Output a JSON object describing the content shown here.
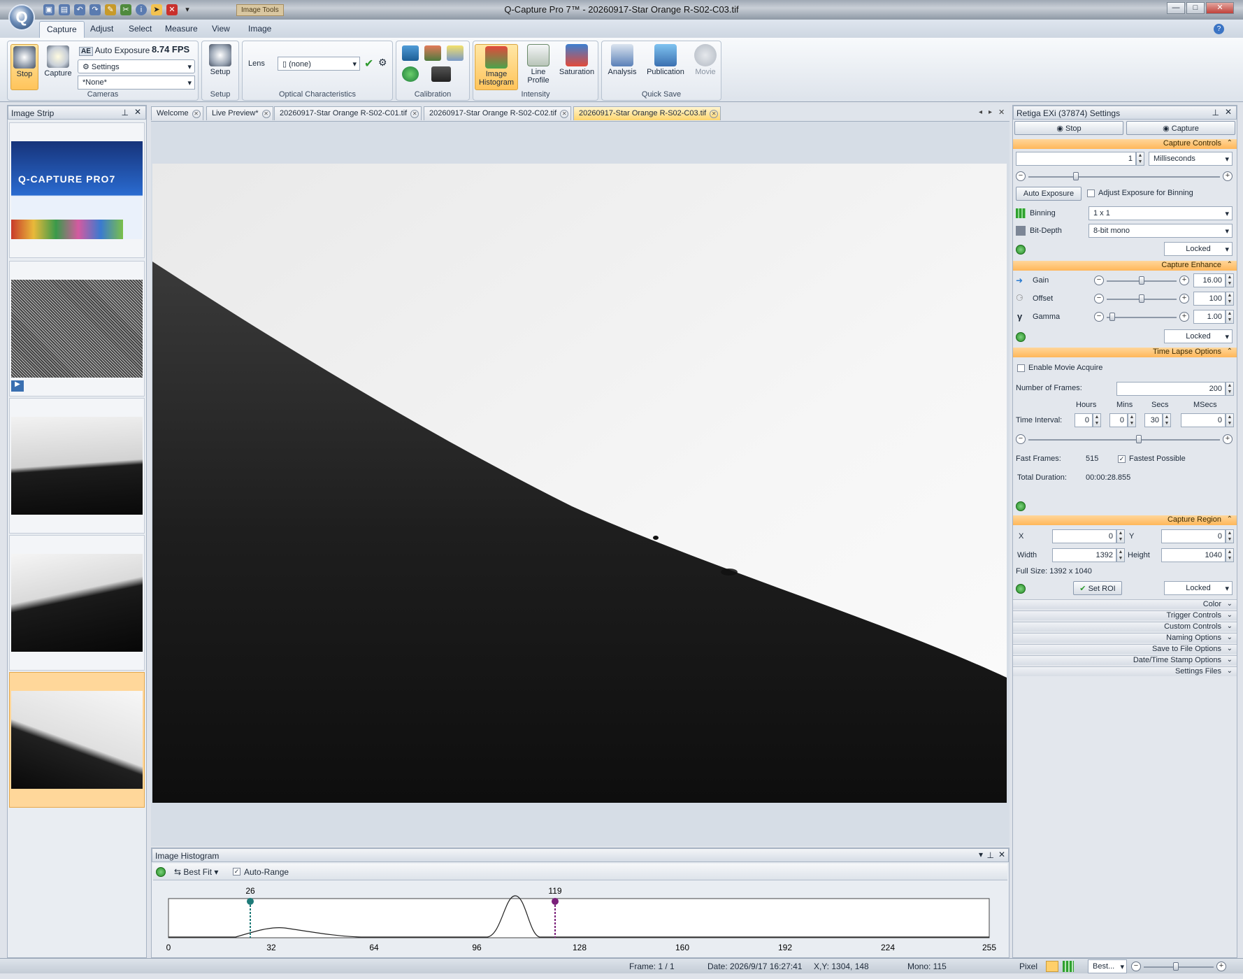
{
  "app": {
    "title": "Q-Capture Pro 7™ - 20260917-Star Orange R-S02-C03.tif",
    "context_tab": "Image Tools"
  },
  "menu": [
    "Capture",
    "Adjust",
    "Select",
    "Measure",
    "View",
    "Image"
  ],
  "ribbon": {
    "cameras": {
      "stop": "Stop",
      "capture": "Capture",
      "auto_exposure": "Auto Exposure",
      "fps": "8.74 FPS",
      "settings": "Settings",
      "none": "*None*",
      "label": "Cameras"
    },
    "setup": {
      "button": "Setup",
      "label": "Setup"
    },
    "optical": {
      "lens": "Lens",
      "lens_value": "(none)",
      "label": "Optical Characteristics"
    },
    "calibration": {
      "label": "Calibration"
    },
    "intensity": {
      "histogram": [
        "Image",
        "Histogram"
      ],
      "line_profile": [
        "Line",
        "Profile"
      ],
      "saturation": "Saturation",
      "label": "Intensity"
    },
    "quicksave": {
      "analysis": "Analysis",
      "publication": "Publication",
      "movie": "Movie",
      "label": "Quick Save"
    }
  },
  "image_strip": {
    "title": "Image Strip",
    "splash_brand": "Q-CAPTURE PRO7"
  },
  "tabs": [
    "Welcome",
    "Live Preview*",
    "20260917-Star Orange R-S02-C01.tif",
    "20260917-Star Orange R-S02-C02.tif",
    "20260917-Star Orange R-S02-C03.tif"
  ],
  "settings": {
    "title": "Retiga EXi (37874) Settings",
    "stop": "Stop",
    "capture": "Capture",
    "capture_controls": "Capture Controls",
    "exposure_value": "1",
    "exposure_unit": "Milliseconds",
    "auto_exposure": "Auto Exposure",
    "adjust_binning": "Adjust Exposure for Binning",
    "binning_label": "Binning",
    "binning_value": "1 x 1",
    "bitdepth_label": "Bit-Depth",
    "bitdepth_value": "8-bit mono",
    "locked": "Locked",
    "capture_enhance": "Capture Enhance",
    "gain_label": "Gain",
    "gain_value": "16.00",
    "offset_label": "Offset",
    "offset_value": "100",
    "gamma_label": "Gamma",
    "gamma_value": "1.00",
    "time_lapse": "Time Lapse Options",
    "enable_movie": "Enable Movie Acquire",
    "num_frames_label": "Number of  Frames:",
    "num_frames": "200",
    "hours": "Hours",
    "mins": "Mins",
    "secs": "Secs",
    "msecs": "MSecs",
    "time_interval": "Time Interval:",
    "h_val": "0",
    "m_val": "0",
    "s_val": "30",
    "ms_val": "0",
    "fast_frames_label": "Fast Frames:",
    "fast_frames": "515",
    "fastest_possible": "Fastest Possible",
    "total_duration_label": "Total Duration:",
    "total_duration": "00:00:28.855",
    "capture_region": "Capture Region",
    "x_label": "X",
    "x_val": "0",
    "y_label": "Y",
    "y_val": "0",
    "width_label": "Width",
    "width_val": "1392",
    "height_label": "Height",
    "height_val": "1040",
    "full_size": "Full Size: 1392 x 1040",
    "set_roi": "Set ROI",
    "collapsed": [
      "Color",
      "Trigger Controls",
      "Custom Controls",
      "Naming Options",
      "Save to File Options",
      "Date/Time Stamp Options",
      "Settings Files"
    ]
  },
  "histogram": {
    "title": "Image Histogram",
    "best_fit": "Best Fit",
    "auto_range": "Auto-Range",
    "min_marker": "26",
    "max_marker": "119",
    "ticks": [
      "0",
      "32",
      "64",
      "96",
      "128",
      "160",
      "192",
      "224",
      "255"
    ]
  },
  "status": {
    "frame": "Frame: 1 / 1",
    "date": "Date: 2026/9/17 16:27:41",
    "xy": "X,Y: 1304,  148",
    "mono": "Mono:  115",
    "pixel": "Pixel",
    "zoom": "Best..."
  }
}
